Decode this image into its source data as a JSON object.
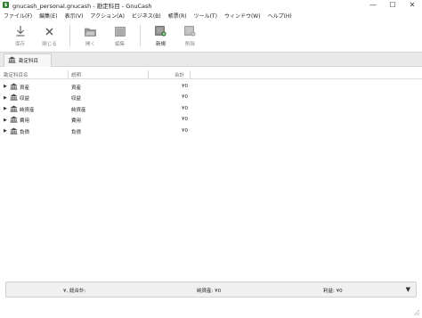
{
  "window": {
    "title": "gnucash_personal.gnucash - 勘定科目 - GnuCash",
    "minimize_glyph": "—",
    "maximize_glyph": "☐",
    "close_glyph": "✕"
  },
  "menubar": {
    "items": [
      {
        "label": "ファイル(F)"
      },
      {
        "label": "編集(E)"
      },
      {
        "label": "表示(V)"
      },
      {
        "label": "アクション(A)"
      },
      {
        "label": "ビジネス(B)"
      },
      {
        "label": "帳票(R)"
      },
      {
        "label": "ツール(T)"
      },
      {
        "label": "ウィンドウ(W)"
      },
      {
        "label": "ヘルプ(H)"
      }
    ]
  },
  "toolbar": {
    "save_label": "保存",
    "close_label": "閉じる",
    "open_label": "開く",
    "edit_label": "編集",
    "new_label": "新規",
    "delete_label": "削除",
    "save_icon": "download-arrow-icon",
    "close_icon": "close-x-icon",
    "open_icon": "folder-icon",
    "edit_icon": "ledger-edit-icon",
    "new_icon": "new-account-icon",
    "delete_icon": "delete-account-icon"
  },
  "tabs": [
    {
      "label": "勘定科目",
      "icon": "bank-icon",
      "active": true
    }
  ],
  "account_tree": {
    "columns": {
      "name": "勘定科目名",
      "description": "説明",
      "total": "合計"
    },
    "rows": [
      {
        "name": "資産",
        "description": "資産",
        "total": "¥0"
      },
      {
        "name": "収益",
        "description": "収益",
        "total": "¥0"
      },
      {
        "name": "純資産",
        "description": "純資産",
        "total": "¥0"
      },
      {
        "name": "費用",
        "description": "費用",
        "total": "¥0"
      },
      {
        "name": "負債",
        "description": "負債",
        "total": "¥0"
      }
    ]
  },
  "summary_bar": {
    "grand_total": "¥, 総合計:",
    "net_assets": "純資産: ¥0",
    "profit": "利益: ¥0",
    "dropdown_icon": "triangle-down-icon"
  },
  "colors": {
    "icon_gray": "#555555",
    "bank_icon": "#4a4a4a",
    "tab_bg": "#f7f7f7",
    "tabstrip_bg": "#e9e9e9"
  }
}
